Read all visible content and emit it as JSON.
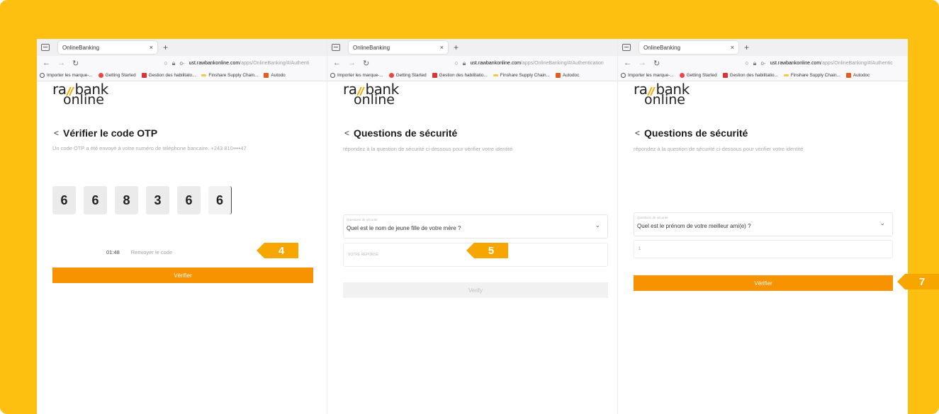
{
  "colors": {
    "frame": "#FDC010",
    "accent_button": "#F79200",
    "badge": "#F7A600",
    "logo_mark": "#F7A600"
  },
  "panels": [
    {
      "tab_title": "OnlineBanking",
      "tab_close": "×",
      "new_tab": "+",
      "url_host": "ust.rawbankonline.com",
      "url_path": "/apps/OnlineBanking/#/Authenti",
      "bookmarks": [
        "Importer les marque-...",
        "Getting Started",
        "Gestion des habilitato...",
        "Finshare Supply Chain...",
        "Autodo"
      ],
      "logo_top_left": "ra",
      "logo_top_right": "bank",
      "logo_bottom": "online",
      "title": "Vérifier le code OTP",
      "subtitle": "Un code OTP a été envoyé à votre numéro de téléphone bancaire. +243 810••••47",
      "otp_digits": [
        "6",
        "6",
        "8",
        "3",
        "6",
        "6"
      ],
      "timer": "01:48",
      "resend": "Renvoyer le code",
      "button": "Vérifier",
      "step": "4"
    },
    {
      "tab_title": "OnlineBanking",
      "tab_close": "×",
      "new_tab": "+",
      "url_host": "ust.rawbankonline.com",
      "url_path": "/apps/OnlineBanking/#/Authentication",
      "bookmarks": [
        "Importer les marque-...",
        "Getting Started",
        "Gestion des habilitatio...",
        "Finshare Supply Chain...",
        "Autodoc"
      ],
      "logo_top_left": "ra",
      "logo_top_right": "bank",
      "logo_bottom": "online",
      "title": "Questions de sécurité",
      "subtitle": "répondez à la question de sécurité ci-dessous pour vérifier votre identité",
      "select_label": "Questions de sécurité",
      "select_value": "Quel est le nom de jeune fille de votre mère ?",
      "answer_placeholder": "VOTRE RÉPONSE",
      "button": "Verify",
      "step": "5"
    },
    {
      "tab_title": "OnlineBanking",
      "tab_close": "×",
      "new_tab": "+",
      "url_host": "ust.rawbankonline.com",
      "url_path": "/apps/OnlineBanking/#/Authentic",
      "bookmarks": [
        "Importer les marque-...",
        "Getting Started",
        "Gestion des habilitatio...",
        "Finshare Supply Chain...",
        "Autodoc"
      ],
      "logo_top_left": "ra",
      "logo_top_right": "bank",
      "logo_bottom": "online",
      "title": "Questions de sécurité",
      "subtitle": "répondez à la question de sécurité ci-dessous pour vérifier votre identité",
      "select_label": "Questions de sécurité",
      "select_value": "Quel est le prénom de votre meilleur ami(e) ?",
      "answer_value": "1",
      "button": "Vérifier",
      "step": "7"
    }
  ]
}
